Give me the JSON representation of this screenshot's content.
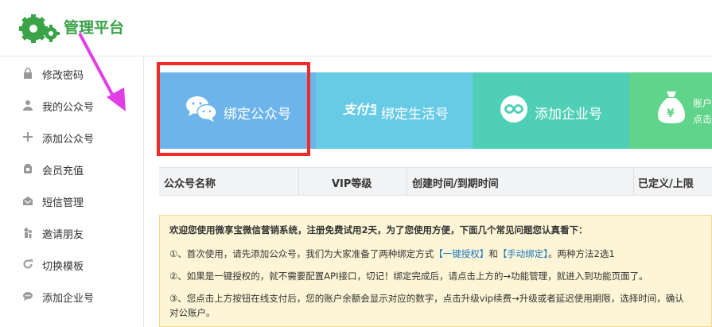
{
  "header": {
    "title": "管理平台",
    "logo_icon": "gears-logo-icon"
  },
  "sidebar": {
    "items": [
      {
        "label": "修改密码",
        "icon": "lock-icon"
      },
      {
        "label": "我的公众号",
        "icon": "user-icon"
      },
      {
        "label": "添加公众号",
        "icon": "plus-icon"
      },
      {
        "label": "会员充值",
        "icon": "wallet-icon"
      },
      {
        "label": "短信管理",
        "icon": "envelope-icon"
      },
      {
        "label": "邀请朋友",
        "icon": "people-icon"
      },
      {
        "label": "切换模板",
        "icon": "refresh-icon"
      },
      {
        "label": "添加企业号",
        "icon": "chat-icon"
      }
    ]
  },
  "tiles": [
    {
      "label": "绑定公众号",
      "icon": "wechat-icon",
      "color": "#6cb4ea"
    },
    {
      "label": "绑定生活号",
      "icon": "alipay-life-icon",
      "color": "#67cbe6"
    },
    {
      "label": "添加企业号",
      "icon": "link-icon",
      "color": "#4fd0b6"
    },
    {
      "label": "账户",
      "sub": "点击",
      "icon": "money-bag-icon",
      "color": "#5fd48a"
    }
  ],
  "table": {
    "headers": [
      "公众号名称",
      "VIP等级",
      "创建时间/到期时间",
      "已定义/上限"
    ]
  },
  "notice": {
    "title": "欢迎您使用微享宝微信营销系统，注册免费试用2天，为了您使用方便，下面几个常见问题您认真看下：",
    "line1_pre": "①、首次使用，请先添加公众号，我们为大家准备了两种绑定方式",
    "line1_link1": "【一键授权】",
    "line1_mid": "和",
    "line1_link2": "【手动绑定】",
    "line1_post": "。两种方法2选1",
    "line2": "②、如果是一键授权的，就不需要配置API接口，切记！绑定完成后，请点击上方的→功能管理，就进入到功能页面了。",
    "line3a": "③、您点击上方按钮在线支付后，您的账户余额会显示对应的数字，点击升级vip续费→升级或者延迟使用期限，选择时间，确认",
    "line3b": "对公账户。"
  },
  "colors": {
    "brand": "#3aa348",
    "highlight_box": "#ee2a2a",
    "arrow": "#e23ee6"
  }
}
